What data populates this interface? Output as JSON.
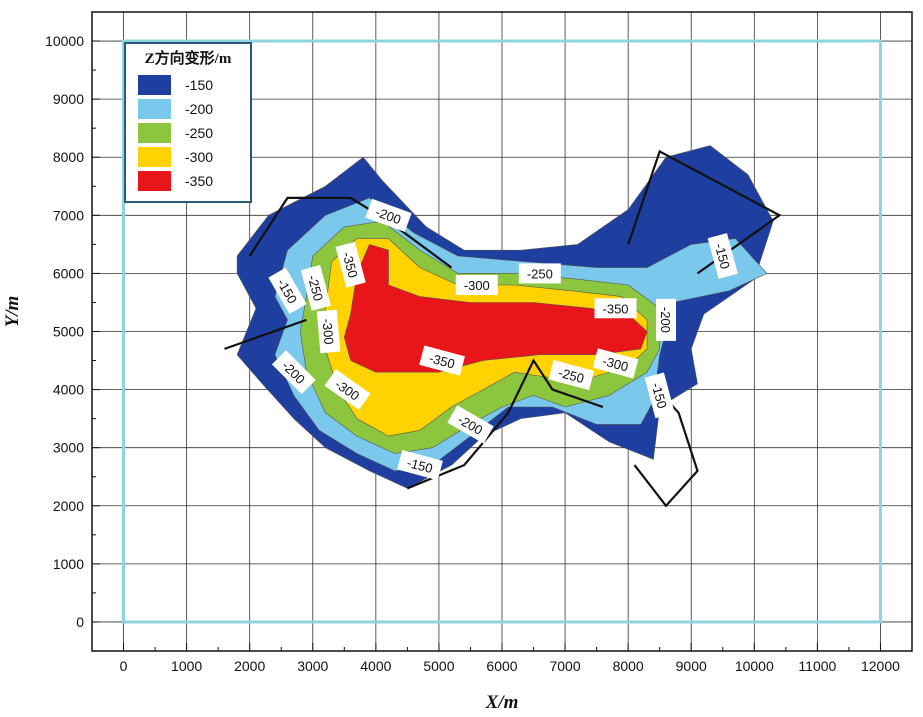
{
  "chart_data": {
    "type": "contour",
    "xlabel": "X/m",
    "ylabel": "Y/m",
    "xlim": [
      -500,
      12500
    ],
    "ylim": [
      -500,
      10500
    ],
    "x_ticks": [
      0,
      1000,
      2000,
      3000,
      4000,
      5000,
      6000,
      7000,
      8000,
      9000,
      10000,
      11000,
      12000
    ],
    "y_ticks": [
      0,
      1000,
      2000,
      3000,
      4000,
      5000,
      6000,
      7000,
      8000,
      9000,
      10000
    ],
    "grid": true,
    "legend": {
      "title": "Z方向变形/m",
      "placement": "top-left",
      "entries": [
        {
          "label": "-150",
          "color": "#1e3fa0"
        },
        {
          "label": "-200",
          "color": "#7ac8ec"
        },
        {
          "label": "-250",
          "color": "#8cc63f"
        },
        {
          "label": "-300",
          "color": "#ffd200"
        },
        {
          "label": "-350",
          "color": "#e8161b"
        }
      ]
    },
    "levels": [
      {
        "level": -150,
        "color": "#1e3fa0",
        "polygon": [
          [
            1800,
            6300
          ],
          [
            2300,
            7000
          ],
          [
            3200,
            7500
          ],
          [
            3800,
            8000
          ],
          [
            4100,
            7600
          ],
          [
            4800,
            6800
          ],
          [
            5400,
            6400
          ],
          [
            6300,
            6400
          ],
          [
            7200,
            6500
          ],
          [
            8000,
            7100
          ],
          [
            8600,
            8000
          ],
          [
            9300,
            8200
          ],
          [
            9900,
            7700
          ],
          [
            10300,
            6900
          ],
          [
            10000,
            5900
          ],
          [
            9200,
            5300
          ],
          [
            9000,
            4700
          ],
          [
            9100,
            4100
          ],
          [
            8500,
            3700
          ],
          [
            8400,
            2800
          ],
          [
            7700,
            3100
          ],
          [
            7000,
            3600
          ],
          [
            6300,
            3500
          ],
          [
            5700,
            3200
          ],
          [
            5200,
            2700
          ],
          [
            4500,
            2300
          ],
          [
            3900,
            2600
          ],
          [
            3200,
            3000
          ],
          [
            2700,
            3500
          ],
          [
            2200,
            4100
          ],
          [
            1800,
            4600
          ],
          [
            2100,
            5400
          ],
          [
            1800,
            6000
          ]
        ]
      },
      {
        "level": -200,
        "color": "#7ac8ec",
        "polygon": [
          [
            2400,
            5600
          ],
          [
            2600,
            6400
          ],
          [
            3200,
            7000
          ],
          [
            3900,
            7300
          ],
          [
            4600,
            6700
          ],
          [
            5300,
            6300
          ],
          [
            6400,
            6200
          ],
          [
            7500,
            6100
          ],
          [
            8300,
            6100
          ],
          [
            9000,
            6500
          ],
          [
            9700,
            6600
          ],
          [
            10200,
            6000
          ],
          [
            9600,
            5700
          ],
          [
            8700,
            5500
          ],
          [
            8600,
            5000
          ],
          [
            8500,
            4600
          ],
          [
            8400,
            3800
          ],
          [
            8200,
            3400
          ],
          [
            7500,
            3400
          ],
          [
            6800,
            3700
          ],
          [
            6100,
            3700
          ],
          [
            5500,
            3200
          ],
          [
            4900,
            2700
          ],
          [
            4300,
            2600
          ],
          [
            3700,
            2900
          ],
          [
            3100,
            3300
          ],
          [
            2700,
            3900
          ],
          [
            2400,
            4600
          ],
          [
            2600,
            5200
          ]
        ]
      },
      {
        "level": -250,
        "color": "#8cc63f",
        "polygon": [
          [
            2900,
            5600
          ],
          [
            3000,
            6300
          ],
          [
            3500,
            6800
          ],
          [
            4100,
            6900
          ],
          [
            4700,
            6400
          ],
          [
            5300,
            6000
          ],
          [
            6200,
            6000
          ],
          [
            7200,
            5900
          ],
          [
            8000,
            5800
          ],
          [
            8500,
            5400
          ],
          [
            8500,
            4700
          ],
          [
            8300,
            4300
          ],
          [
            7700,
            3900
          ],
          [
            7000,
            3700
          ],
          [
            6500,
            3900
          ],
          [
            6000,
            3700
          ],
          [
            5500,
            3400
          ],
          [
            4900,
            3000
          ],
          [
            4300,
            2900
          ],
          [
            3700,
            3200
          ],
          [
            3200,
            3600
          ],
          [
            2900,
            4300
          ],
          [
            2800,
            5000
          ]
        ]
      },
      {
        "level": -300,
        "color": "#ffd200",
        "polygon": [
          [
            3200,
            5400
          ],
          [
            3300,
            6200
          ],
          [
            3700,
            6600
          ],
          [
            4200,
            6600
          ],
          [
            4700,
            6100
          ],
          [
            5300,
            5800
          ],
          [
            6200,
            5800
          ],
          [
            7100,
            5700
          ],
          [
            7900,
            5600
          ],
          [
            8300,
            5200
          ],
          [
            8300,
            4700
          ],
          [
            8000,
            4400
          ],
          [
            7400,
            4200
          ],
          [
            6800,
            4200
          ],
          [
            6200,
            4300
          ],
          [
            5700,
            4000
          ],
          [
            5200,
            3700
          ],
          [
            4700,
            3300
          ],
          [
            4200,
            3200
          ],
          [
            3700,
            3500
          ],
          [
            3400,
            4000
          ],
          [
            3200,
            4700
          ]
        ]
      },
      {
        "level": -350,
        "color": "#e8161b",
        "polygon": [
          [
            3600,
            5300
          ],
          [
            3700,
            6000
          ],
          [
            3900,
            6500
          ],
          [
            4200,
            6400
          ],
          [
            4200,
            5800
          ],
          [
            4700,
            5600
          ],
          [
            5500,
            5500
          ],
          [
            6500,
            5500
          ],
          [
            7400,
            5400
          ],
          [
            8000,
            5300
          ],
          [
            8300,
            5000
          ],
          [
            8200,
            4700
          ],
          [
            7500,
            4600
          ],
          [
            6600,
            4600
          ],
          [
            5700,
            4500
          ],
          [
            5000,
            4300
          ],
          [
            4500,
            4300
          ],
          [
            4000,
            4300
          ],
          [
            3600,
            4500
          ],
          [
            3500,
            4900
          ]
        ]
      }
    ],
    "boundary_lines": [
      [
        [
          2000,
          6300
        ],
        [
          2600,
          7300
        ],
        [
          3600,
          7300
        ],
        [
          4200,
          6900
        ],
        [
          5200,
          6100
        ]
      ],
      [
        [
          8000,
          6500
        ],
        [
          8500,
          8100
        ],
        [
          10400,
          7000
        ],
        [
          9100,
          6000
        ]
      ],
      [
        [
          1600,
          4700
        ],
        [
          2900,
          5200
        ]
      ],
      [
        [
          4500,
          2300
        ],
        [
          5400,
          2700
        ],
        [
          6100,
          3600
        ],
        [
          6500,
          4500
        ],
        [
          6800,
          4000
        ],
        [
          7600,
          3700
        ]
      ],
      [
        [
          8300,
          4200
        ],
        [
          8800,
          3600
        ],
        [
          9100,
          2600
        ],
        [
          8600,
          2000
        ],
        [
          8100,
          2700
        ]
      ]
    ],
    "study_area": {
      "x": [
        0,
        12000
      ],
      "y": [
        0,
        10000
      ]
    },
    "contour_labels": [
      {
        "text": "-150",
        "x": 2600,
        "y": 5700,
        "angle": 60
      },
      {
        "text": "-250",
        "x": 3050,
        "y": 5750,
        "angle": 75
      },
      {
        "text": "-350",
        "x": 3600,
        "y": 6150,
        "angle": 75
      },
      {
        "text": "-300",
        "x": 3250,
        "y": 5000,
        "angle": 85
      },
      {
        "text": "-200",
        "x": 4200,
        "y": 7000,
        "angle": 20
      },
      {
        "text": "-200",
        "x": 2700,
        "y": 4300,
        "angle": 45
      },
      {
        "text": "-300",
        "x": 3550,
        "y": 4000,
        "angle": 35
      },
      {
        "text": "-350",
        "x": 5050,
        "y": 4500,
        "angle": 15
      },
      {
        "text": "-300",
        "x": 5600,
        "y": 5800,
        "angle": 0
      },
      {
        "text": "-250",
        "x": 6600,
        "y": 6000,
        "angle": 0
      },
      {
        "text": "-350",
        "x": 7800,
        "y": 5400,
        "angle": 0
      },
      {
        "text": "-200",
        "x": 8600,
        "y": 5200,
        "angle": 90
      },
      {
        "text": "-300",
        "x": 7800,
        "y": 4450,
        "angle": 15
      },
      {
        "text": "-250",
        "x": 7100,
        "y": 4250,
        "angle": 15
      },
      {
        "text": "-150",
        "x": 8500,
        "y": 3900,
        "angle": 75
      },
      {
        "text": "-200",
        "x": 5500,
        "y": 3400,
        "angle": 30
      },
      {
        "text": "-150",
        "x": 4700,
        "y": 2700,
        "angle": 15
      },
      {
        "text": "-150",
        "x": 9500,
        "y": 6300,
        "angle": 75
      }
    ]
  }
}
